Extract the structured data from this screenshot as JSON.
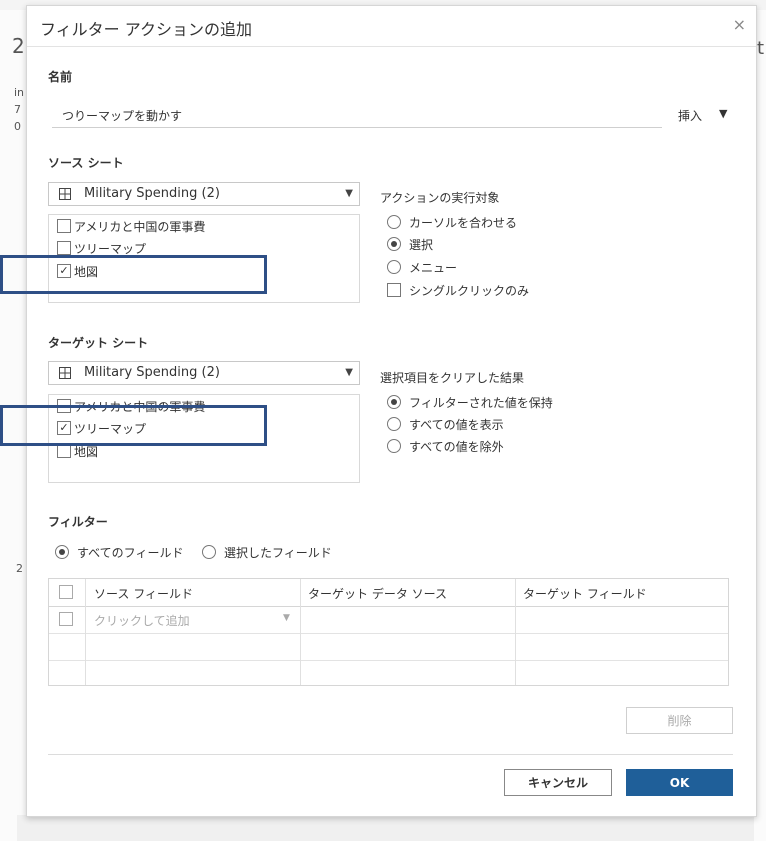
{
  "dialog": {
    "title": "フィルター アクションの追加",
    "close_glyph": "×"
  },
  "name_section": {
    "label": "名前",
    "value": "つりーマップを動かす",
    "insert_label": "挿入",
    "insert_arrow": "▼"
  },
  "source_sheet": {
    "label": "ソース シート",
    "dropdown_value": "Military Spending (2)",
    "items": [
      {
        "label": "アメリカと中国の軍事費",
        "checked": ""
      },
      {
        "label": "ツリーマップ",
        "checked": ""
      },
      {
        "label": "地図",
        "checked": "✓"
      }
    ]
  },
  "run_action": {
    "label": "アクションの実行対象",
    "options": [
      {
        "label": "カーソルを合わせる",
        "selected": false
      },
      {
        "label": "選択",
        "selected": true
      },
      {
        "label": "メニュー",
        "selected": false
      }
    ],
    "single_click_label": "シングルクリックのみ"
  },
  "target_sheet": {
    "label": "ターゲット シート",
    "dropdown_value": "Military Spending (2)",
    "items": [
      {
        "label": "アメリカと中国の軍事費",
        "checked": ""
      },
      {
        "label": "ツリーマップ",
        "checked": "✓"
      },
      {
        "label": "地図",
        "checked": ""
      }
    ]
  },
  "clear_selection": {
    "label": "選択項目をクリアした結果",
    "options": [
      {
        "label": "フィルターされた値を保持",
        "selected": true
      },
      {
        "label": "すべての値を表示",
        "selected": false
      },
      {
        "label": "すべての値を除外",
        "selected": false
      }
    ]
  },
  "filter": {
    "label": "フィルター",
    "all_fields_label": "すべてのフィールド",
    "selected_fields_label": "選択したフィールド",
    "columns": [
      "ソース フィールド",
      "ターゲット データ ソース",
      "ターゲット フィールド"
    ],
    "add_placeholder": "クリックして追加",
    "add_arrow": "▼"
  },
  "buttons": {
    "delete": "削除",
    "cancel": "キャンセル",
    "ok": "OK"
  },
  "background": {
    "chars": [
      "2",
      "t",
      "in",
      "7",
      "0",
      "2"
    ]
  },
  "colors": {
    "accent": "#1f5f99",
    "highlight": "#2e4f86"
  }
}
